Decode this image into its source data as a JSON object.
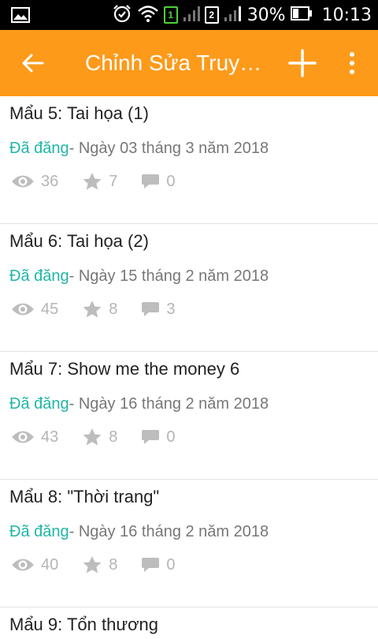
{
  "status_bar": {
    "battery": "30%",
    "time": "10:13",
    "sim1_label": "1",
    "sim2_label": "2"
  },
  "app_bar": {
    "title": "Chỉnh Sửa Truy…"
  },
  "parts": [
    {
      "title": "Mẩu 5: Tai họa (1)",
      "status": "Đã đăng",
      "date": "- Ngày 03 tháng 3 năm 2018",
      "views": "36",
      "votes": "7",
      "comments": "0"
    },
    {
      "title": "Mẩu 6: Tai họa (2)",
      "status": "Đã đăng",
      "date": "- Ngày 15 tháng 2 năm 2018",
      "views": "45",
      "votes": "8",
      "comments": "3"
    },
    {
      "title": "Mẩu 7: Show me the money 6",
      "status": "Đã đăng",
      "date": "- Ngày 16 tháng 2 năm 2018",
      "views": "43",
      "votes": "8",
      "comments": "0"
    },
    {
      "title": "Mẩu 8: \"Thời trang\"",
      "status": "Đã đăng",
      "date": "- Ngày 16 tháng 2 năm 2018",
      "views": "40",
      "votes": "8",
      "comments": "0"
    },
    {
      "title": "Mẩu 9: Tổn thương"
    }
  ],
  "colors": {
    "app_bar": "#fd9a1a",
    "published": "#1fb6a6",
    "stat_icon": "#bdbdbd"
  },
  "icons": {
    "back": "arrow-left-icon",
    "add": "plus-icon",
    "more": "more-vertical-icon",
    "views": "eye-icon",
    "votes": "star-icon",
    "comments": "comment-icon"
  }
}
